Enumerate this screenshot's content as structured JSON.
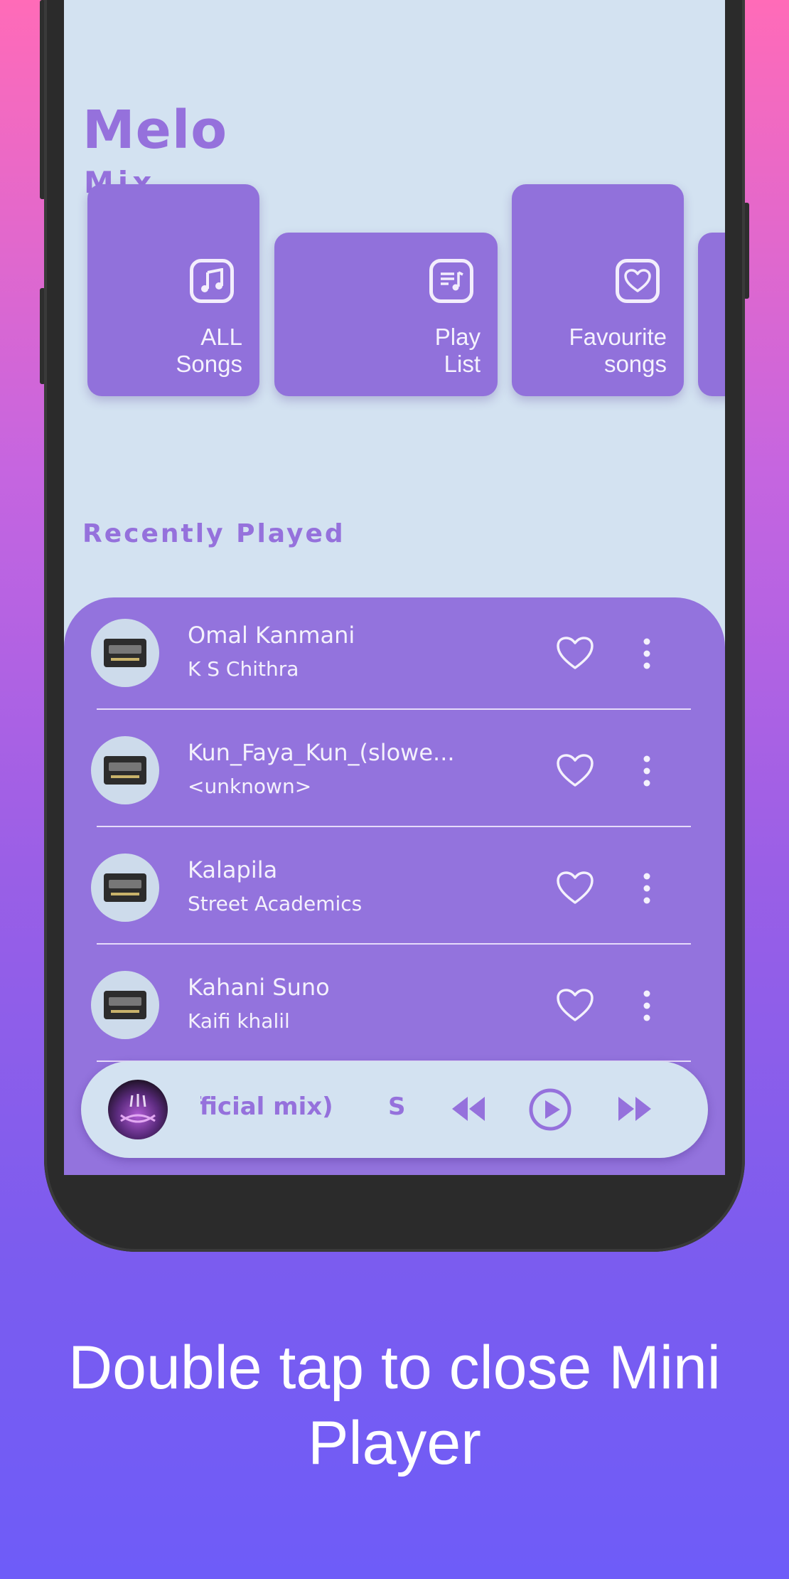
{
  "app": {
    "logo_title": "Melo",
    "logo_subtitle": "Mix"
  },
  "categories": [
    {
      "line1": "ALL",
      "line2": "Songs",
      "icon": "music-note-icon"
    },
    {
      "line1": "Play",
      "line2": "List",
      "icon": "playlist-icon"
    },
    {
      "line1": "Favourite",
      "line2": "songs",
      "icon": "heart-icon"
    }
  ],
  "recent": {
    "title": "Recently Played",
    "items": [
      {
        "title": "Omal Kanmani",
        "artist": "K S Chithra"
      },
      {
        "title": "Kun_Faya_Kun_(slowe...",
        "artist": "<unknown>"
      },
      {
        "title": "Kalapila",
        "artist": "Street Academics"
      },
      {
        "title": "Kahani Suno",
        "artist": "Kaifi khalil"
      }
    ]
  },
  "mini_player": {
    "marquee_text": "fficial mix)",
    "marquee_next": "S"
  },
  "caption": "Double tap to close Mini Player",
  "colors": {
    "accent": "#9571dc",
    "card": "#9171db",
    "screen_bg": "#d3e2f1",
    "panel": "#9373dd"
  }
}
